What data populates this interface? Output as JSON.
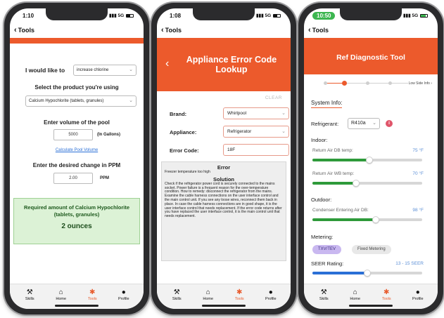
{
  "phone1": {
    "status": {
      "time": "1:10",
      "signal": "5G"
    },
    "nav": {
      "back": "‹",
      "title": "Tools"
    },
    "like_label": "I would like to",
    "action_select": "increase chlorine",
    "product_label": "Select the product you're using",
    "product_select": "Calcium Hypochlorite (tablets, granules)",
    "volume_label": "Enter volume of the pool",
    "volume_value": "5000",
    "volume_unit": "(In Gallons)",
    "calc_link": "Calculate Pool Volume",
    "change_label": "Enter the desired change in PPM",
    "change_value": "2.00",
    "change_unit": "PPM",
    "result_title": "Required amount of Calcium Hypochlorite (tablets, granules)",
    "result_value": "2 ounces"
  },
  "phone2": {
    "status": {
      "time": "1:08",
      "signal": "5G"
    },
    "nav": {
      "back": "‹",
      "title": "Tools"
    },
    "header_back": "‹",
    "header_title": "Appliance Error Code Lookup",
    "clear": "CLEAR",
    "brand_label": "Brand:",
    "brand_value": "Whirlpool",
    "appliance_label": "Appliance:",
    "appliance_value": "Refrigerator",
    "code_label": "Error Code:",
    "code_value": "18F",
    "error_heading": "Error",
    "error_text": "Freezer temperature too high",
    "solution_heading": "Solution",
    "solution_text": "Check if the refrigerator power cord is securely connected to the mains socket. Power failure is a frequent reason for the over-temperature condition. How to remedy: disconnect the refrigerator from the mains. Examine the cable harness connections on the user interface control and the main control unit. If you see any loose wires, reconnect them back in place. In case the cable harness connections are in good shape, it is the user interface control that needs replacement. If the error code returns after you have replaced the user interface control, it is the main control unit that needs replacement."
  },
  "phone3": {
    "status": {
      "time": "10:50",
      "signal": "5G"
    },
    "nav": {
      "back": "‹",
      "title": "Tools"
    },
    "header_title": "Ref Diagnostic Tool",
    "step_label": "Low Side Info",
    "system_info": "System Info:",
    "refrigerant_label": "Refrigerant:",
    "refrigerant_value": "R410a",
    "info_icon": "i",
    "indoor": "Indoor:",
    "db_label": "Return Air DB temp:",
    "db_value": "75 °F",
    "db_level": 0.52,
    "wb_label": "Return Air WB temp:",
    "wb_value": "70 °F",
    "wb_level": 0.4,
    "outdoor": "Outdoor:",
    "cond_label": "Condenser Entering Air DB:",
    "cond_value": "98 °F",
    "cond_level": 0.58,
    "metering": "Metering:",
    "metering_on": "TXV/TEV",
    "metering_off": "Fixed Metering",
    "seer_label": "SEER Rating:",
    "seer_value": "13 - 15 SEER",
    "seer_level": 0.5
  },
  "tabs": {
    "skills": "Skills",
    "home": "Home",
    "tools": "Tools",
    "profile": "Profile"
  },
  "colors": {
    "accent": "#ec5a2c",
    "green": "#2e9a3a",
    "link": "#2a6fd6"
  }
}
